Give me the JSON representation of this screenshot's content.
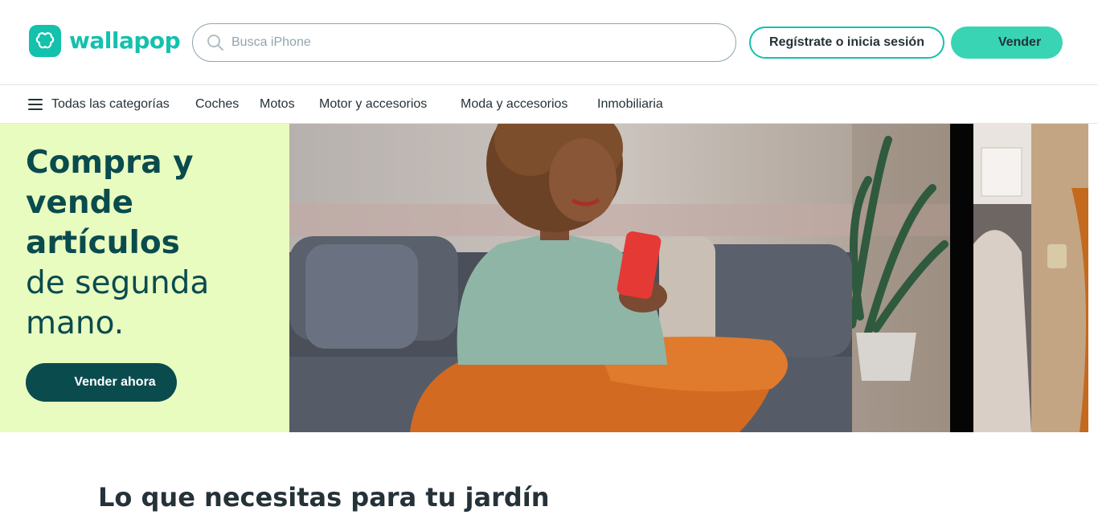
{
  "header": {
    "logo_text": "wallapop",
    "logo_icon": "wallapop-heart-icon",
    "search": {
      "placeholder": "Busca iPhone",
      "value": "",
      "icon": "search-icon"
    },
    "login_label": "Regístrate o inicia sesión",
    "sell_label": "Vender"
  },
  "categories": {
    "all_label": "Todas las categorías",
    "menu_icon": "hamburger-menu-icon",
    "items": [
      "Coches",
      "Motos",
      "Motor y accesorios",
      "Moda y accesorios",
      "Inmobiliaria"
    ]
  },
  "hero": {
    "title_bold_1": "Compra y",
    "title_bold_2": "vende artículos",
    "title_regular_1": "de segunda",
    "title_regular_2": "mano.",
    "cta_label": "Vender ahora",
    "cta_icon": "plus-icon",
    "image": "woman-sitting-on-sofa-with-phone-photo"
  },
  "section": {
    "title": "Lo que necesitas para tu jardín"
  },
  "colors": {
    "brand": "#13c1ac",
    "sell_button": "#38d4b4",
    "hero_bg": "#e9fcc0",
    "hero_text": "#0a4b4e",
    "text": "#253238"
  }
}
